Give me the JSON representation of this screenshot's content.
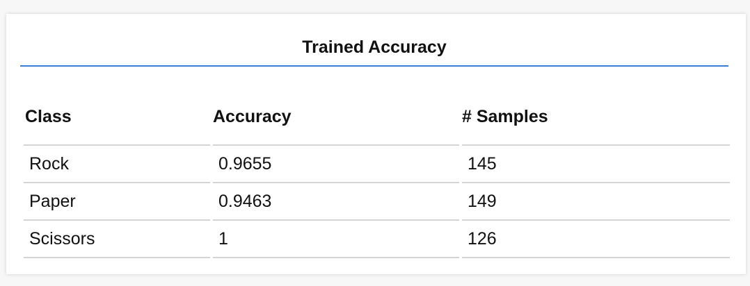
{
  "title": "Trained Accuracy",
  "table": {
    "headers": [
      "Class",
      "Accuracy",
      "# Samples"
    ],
    "rows": [
      [
        "Rock",
        "0.9655",
        "145"
      ],
      [
        "Paper",
        "0.9463",
        "149"
      ],
      [
        "Scissors",
        "1",
        "126"
      ]
    ]
  },
  "colors": {
    "accent": "#3a7bd5",
    "divider": "#d4d4d4",
    "background": "#f7f7f7",
    "card": "#ffffff"
  }
}
